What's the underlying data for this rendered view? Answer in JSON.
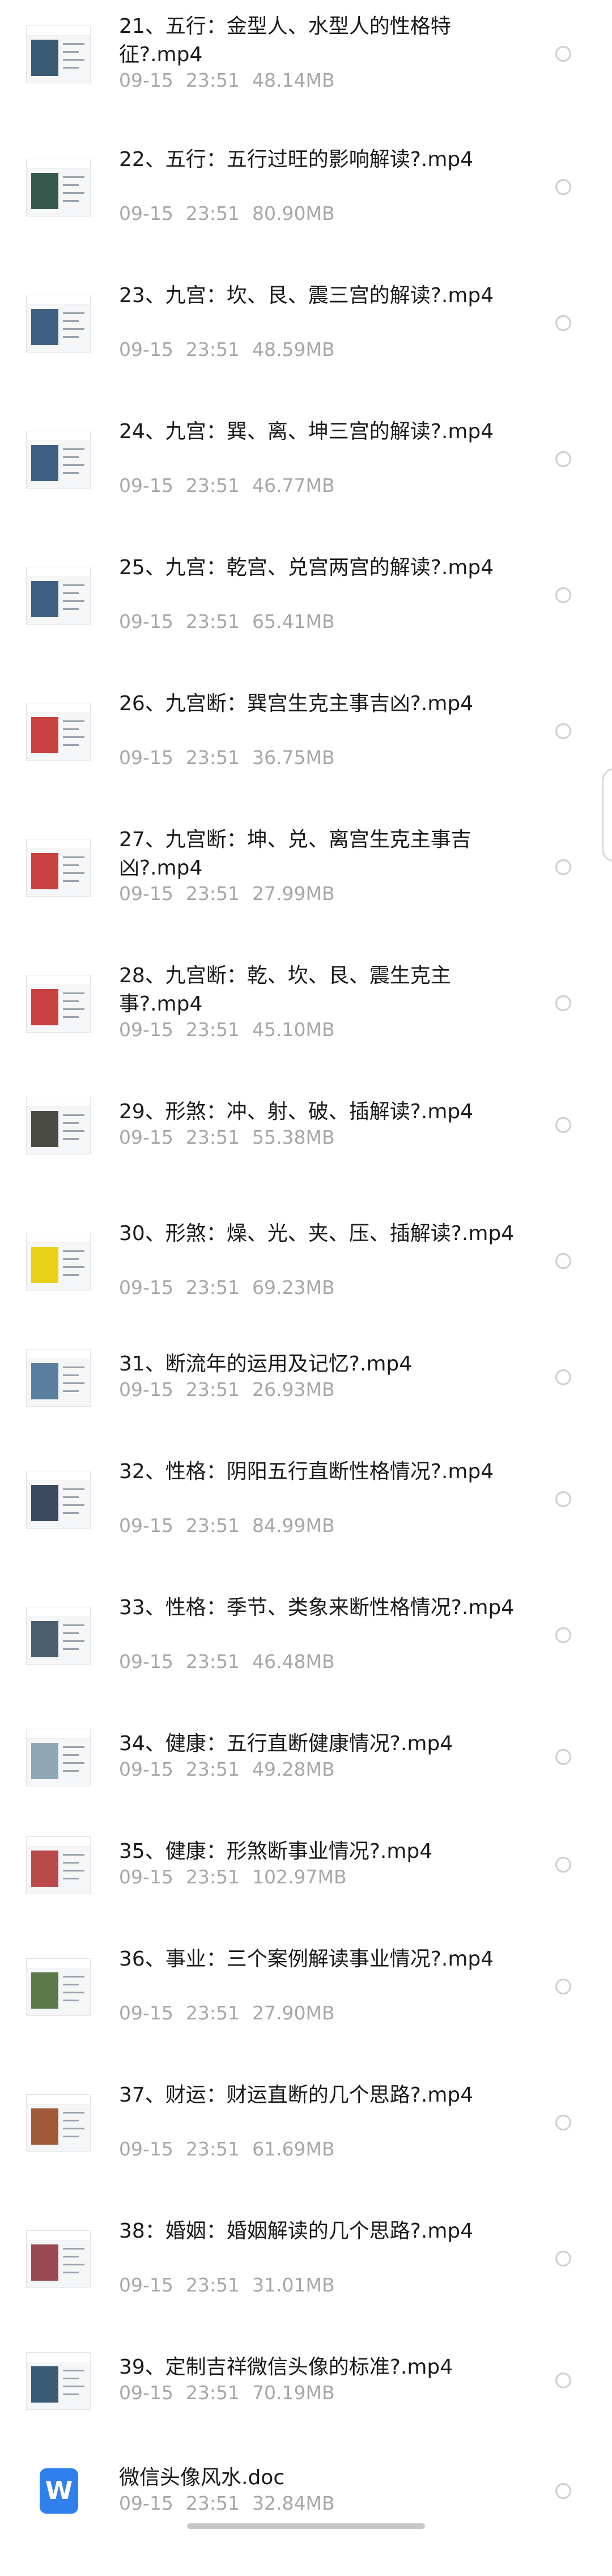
{
  "files": [
    {
      "name": "21、五行：金型人、水型人的性格特征?.mp4",
      "date": "09-15",
      "time": "23:51",
      "size": "48.14MB",
      "type": "video",
      "thumb_color": "#3b5b74"
    },
    {
      "name": "22、五行：五行过旺的影响解读?.mp4",
      "date": "09-15",
      "time": "23:51",
      "size": "80.90MB",
      "type": "video",
      "thumb_color": "#355a4d"
    },
    {
      "name": "23、九宫：坎、艮、震三宫的解读?.mp4",
      "date": "09-15",
      "time": "23:51",
      "size": "48.59MB",
      "type": "video",
      "thumb_color": "#3f5f80"
    },
    {
      "name": "24、九宫：巽、离、坤三宫的解读?.mp4",
      "date": "09-15",
      "time": "23:51",
      "size": "46.77MB",
      "type": "video",
      "thumb_color": "#3f5f80"
    },
    {
      "name": "25、九宫：乾宫、兑宫两宫的解读?.mp4",
      "date": "09-15",
      "time": "23:51",
      "size": "65.41MB",
      "type": "video",
      "thumb_color": "#3f5f80"
    },
    {
      "name": "26、九宫断：巽宫生克主事吉凶?.mp4",
      "date": "09-15",
      "time": "23:51",
      "size": "36.75MB",
      "type": "video",
      "thumb_color": "#c84040"
    },
    {
      "name": "27、九宫断：坤、兑、离宫生克主事吉凶?.mp4",
      "date": "09-15",
      "time": "23:51",
      "size": "27.99MB",
      "type": "video",
      "thumb_color": "#c84040"
    },
    {
      "name": "28、九宫断：乾、坎、艮、震生克主事?.mp4",
      "date": "09-15",
      "time": "23:51",
      "size": "45.10MB",
      "type": "video",
      "thumb_color": "#c84040"
    },
    {
      "name": "29、形煞：冲、射、破、插解读?.mp4",
      "date": "09-15",
      "time": "23:51",
      "size": "55.38MB",
      "type": "video",
      "thumb_color": "#4a4a44"
    },
    {
      "name": "30、形煞：燥、光、夹、压、插解读?.mp4",
      "date": "09-15",
      "time": "23:51",
      "size": "69.23MB",
      "type": "video",
      "thumb_color": "#e8d018"
    },
    {
      "name": "31、断流年的运用及记忆?.mp4",
      "date": "09-15",
      "time": "23:51",
      "size": "26.93MB",
      "type": "video",
      "thumb_color": "#5a7fa0"
    },
    {
      "name": "32、性格：阴阳五行直断性格情况?.mp4",
      "date": "09-15",
      "time": "23:51",
      "size": "84.99MB",
      "type": "video",
      "thumb_color": "#3b4a5e"
    },
    {
      "name": "33、性格：季节、类象来断性格情况?.mp4",
      "date": "09-15",
      "time": "23:51",
      "size": "46.48MB",
      "type": "video",
      "thumb_color": "#4c5f70"
    },
    {
      "name": "34、健康：五行直断健康情况?.mp4",
      "date": "09-15",
      "time": "23:51",
      "size": "49.28MB",
      "type": "video",
      "thumb_color": "#8fa7b7"
    },
    {
      "name": "35、健康：形煞断事业情况?.mp4",
      "date": "09-15",
      "time": "23:51",
      "size": "102.97MB",
      "type": "video",
      "thumb_color": "#b84a4a"
    },
    {
      "name": "36、事业：三个案例解读事业情况?.mp4",
      "date": "09-15",
      "time": "23:51",
      "size": "27.90MB",
      "type": "video",
      "thumb_color": "#5b7a4a"
    },
    {
      "name": "37、财运：财运直断的几个思路?.mp4",
      "date": "09-15",
      "time": "23:51",
      "size": "61.69MB",
      "type": "video",
      "thumb_color": "#a05a3a"
    },
    {
      "name": "38：婚姻：婚姻解读的几个思路?.mp4",
      "date": "09-15",
      "time": "23:51",
      "size": "31.01MB",
      "type": "video",
      "thumb_color": "#9a4a50"
    },
    {
      "name": "39、定制吉祥微信头像的标准?.mp4",
      "date": "09-15",
      "time": "23:51",
      "size": "70.19MB",
      "type": "video",
      "thumb_color": "#3b5b74"
    },
    {
      "name": "微信头像风水.doc",
      "date": "09-15",
      "time": "23:51",
      "size": "32.84MB",
      "type": "doc",
      "icon_letter": "W",
      "thumb_color": "#2f80ed"
    }
  ]
}
